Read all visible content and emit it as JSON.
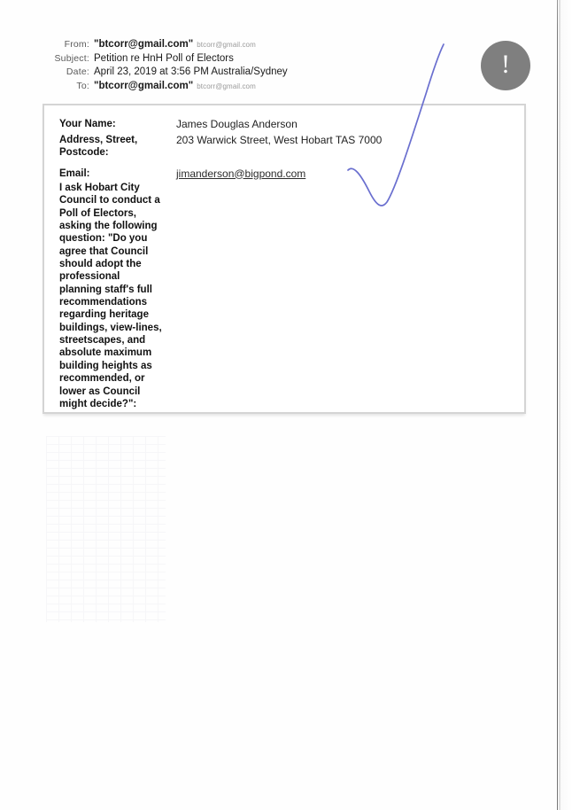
{
  "document": {
    "type": "scanned-email-printout"
  },
  "alert": {
    "icon": "exclamation-icon",
    "glyph": "!",
    "color": "#7f7f7f"
  },
  "annotation": {
    "icon": "handwritten-checkmark",
    "color": "#6a6fcf"
  },
  "mail_header": {
    "rows": [
      {
        "label": "From:",
        "value": "\"btcorr@gmail.com\"",
        "sub": "btcorr@gmail.com",
        "bold": true
      },
      {
        "label": "Subject:",
        "value": "Petition re HnH Poll of Electors",
        "sub": "",
        "bold": false
      },
      {
        "label": "Date:",
        "value": "April 23, 2019 at 3:56 PM Australia/Sydney",
        "sub": "",
        "bold": false
      },
      {
        "label": "To:",
        "value": "\"btcorr@gmail.com\"",
        "sub": "btcorr@gmail.com",
        "bold": true
      }
    ]
  },
  "form": {
    "name_label": "Your Name:",
    "name_value": "James Douglas Anderson",
    "address_label_line1": "Address, Street,",
    "address_label_line2": "Postcode:",
    "address_value": "203 Warwick Street, West Hobart TAS 7000",
    "email_label": "Email:",
    "email_value": "jimanderson@bigpond.com",
    "petition_lines": [
      "I ask Hobart City",
      "Council to conduct a",
      "Poll of Electors,",
      "asking the following",
      "question: \"Do you",
      "agree that Council",
      "should adopt the",
      "professional",
      "planning staff's full",
      "recommendations",
      "regarding heritage",
      "buildings, view-lines,",
      "streetscapes, and",
      "absolute maximum",
      "building heights as",
      "recommended, or",
      "lower as Council",
      "might decide?\":"
    ]
  }
}
